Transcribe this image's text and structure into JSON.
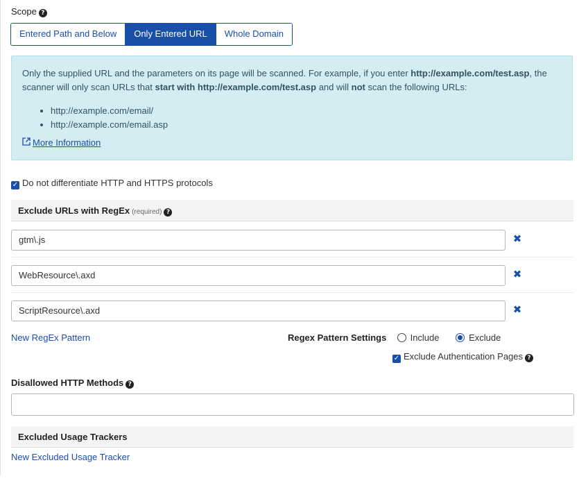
{
  "scope": {
    "title": "Scope",
    "options": [
      "Entered Path and Below",
      "Only Entered URL",
      "Whole Domain"
    ],
    "selected": "Only Entered URL"
  },
  "info": {
    "p1": "Only the supplied URL and the parameters on its page will be scanned. For example, if you enter ",
    "url1": "http://example.com/test.asp",
    "p2": ", the scanner will only scan URLs that ",
    "strong2": "start with http://example.com/test.asp",
    "p3": " and will ",
    "strong3": "not",
    "p4": " scan the following URLs:",
    "examples": [
      "http://example.com/email/",
      "http://example.com/email.asp"
    ],
    "more_link": "More Information",
    "link_icon": "external-link-icon"
  },
  "protocol_checkbox": {
    "label": "Do not differentiate HTTP and HTTPS protocols",
    "checked": true
  },
  "exclude": {
    "title": "Exclude URLs with RegEx",
    "required": "(required)",
    "patterns": [
      "gtm\\.js",
      "WebResource\\.axd",
      "ScriptResource\\.axd"
    ],
    "new_pattern": "New RegEx Pattern"
  },
  "regex_settings": {
    "label": "Regex Pattern Settings",
    "include": "Include",
    "exclude": "Exclude",
    "selected": "Exclude",
    "auth_label": "Exclude Authentication Pages",
    "auth_checked": true
  },
  "disallowed": {
    "title": "Disallowed HTTP Methods",
    "value": ""
  },
  "trackers": {
    "title": "Excluded Usage Trackers",
    "new_tracker": "New Excluded Usage Tracker"
  },
  "colors": {
    "accent": "#1a4fa8",
    "info_bg": "#d3edf2"
  }
}
